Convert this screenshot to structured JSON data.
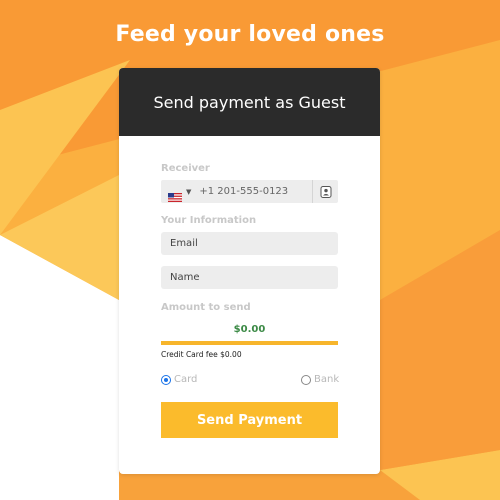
{
  "headline": "Feed your loved ones",
  "card": {
    "title": "Send payment as Guest"
  },
  "receiver": {
    "label": "Receiver",
    "phone_placeholder": "+1 201-555-0123",
    "country_flag_icon": "us-flag-icon",
    "contact_icon": "contact-book-icon"
  },
  "your_info": {
    "label": "Your Information",
    "email_placeholder": "Email",
    "name_placeholder": "Name"
  },
  "amount": {
    "label": "Amount to send",
    "value": "$0.00",
    "fee_text": "Credit Card fee $0.00"
  },
  "payment_method": {
    "options": [
      {
        "label": "Card",
        "checked": true
      },
      {
        "label": "Bank",
        "checked": false
      }
    ]
  },
  "send_button": "Send Payment",
  "colors": {
    "accent": "#fbbb2c",
    "header": "#2b2b2b",
    "amount": "#3c8a46",
    "background": "#f7a43a"
  }
}
